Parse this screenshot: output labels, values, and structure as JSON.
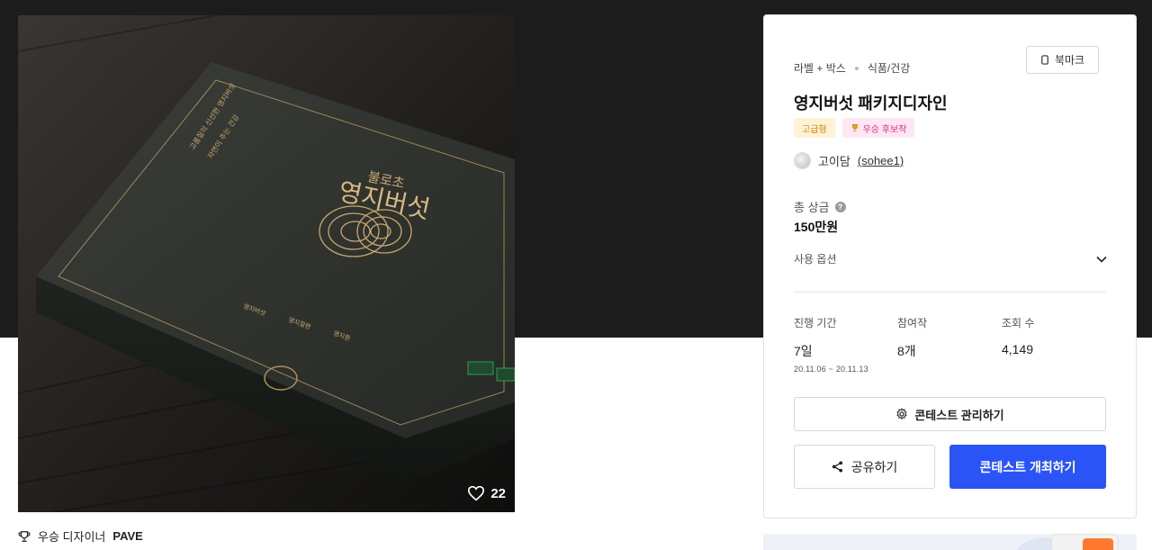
{
  "artwork": {
    "alt_semantic": "product-box-mockup",
    "box_text": {
      "brand": "불로초",
      "name": "영지버섯",
      "side_lines": [
        "고품질의 신선한 영지버섯",
        "자연이 주는 건강"
      ],
      "bottom_items": [
        "영지버섯",
        "영지절편",
        "영지환"
      ]
    },
    "like_count": "22"
  },
  "winner": {
    "label": "우승 디자이너",
    "name": "PAVE"
  },
  "panel": {
    "breadcrumb": [
      "라벨 + 박스",
      "식품/건강"
    ],
    "bookmark_label": "북마크",
    "title": "영지버섯 패키지디자인",
    "badges": {
      "tier": "고급형",
      "award": "우승 후보작"
    },
    "author": {
      "name": "고이담",
      "handle": "(sohee1)"
    },
    "prize": {
      "label": "총 상금",
      "value": "150만원"
    },
    "options_label": "사용 옵션",
    "stats": {
      "duration": {
        "label": "진행 기간",
        "value": "7일",
        "range": "20.11.06 ~ 20.11.13"
      },
      "entries": {
        "label": "참여작",
        "value": "8개"
      },
      "views": {
        "label": "조회 수",
        "value": "4,149"
      }
    },
    "manage_label": "콘테스트 관리하기",
    "share_label": "공유하기",
    "host_label": "콘테스트 개최하기"
  },
  "colors": {
    "primary": "#2b54f6",
    "top_band": "#1c1c1c",
    "gold": "#c9a870"
  },
  "icons": [
    "bookmark-icon",
    "heart-icon",
    "trophy-icon",
    "help-icon",
    "chevron-down-icon",
    "gear-icon",
    "share-icon"
  ]
}
